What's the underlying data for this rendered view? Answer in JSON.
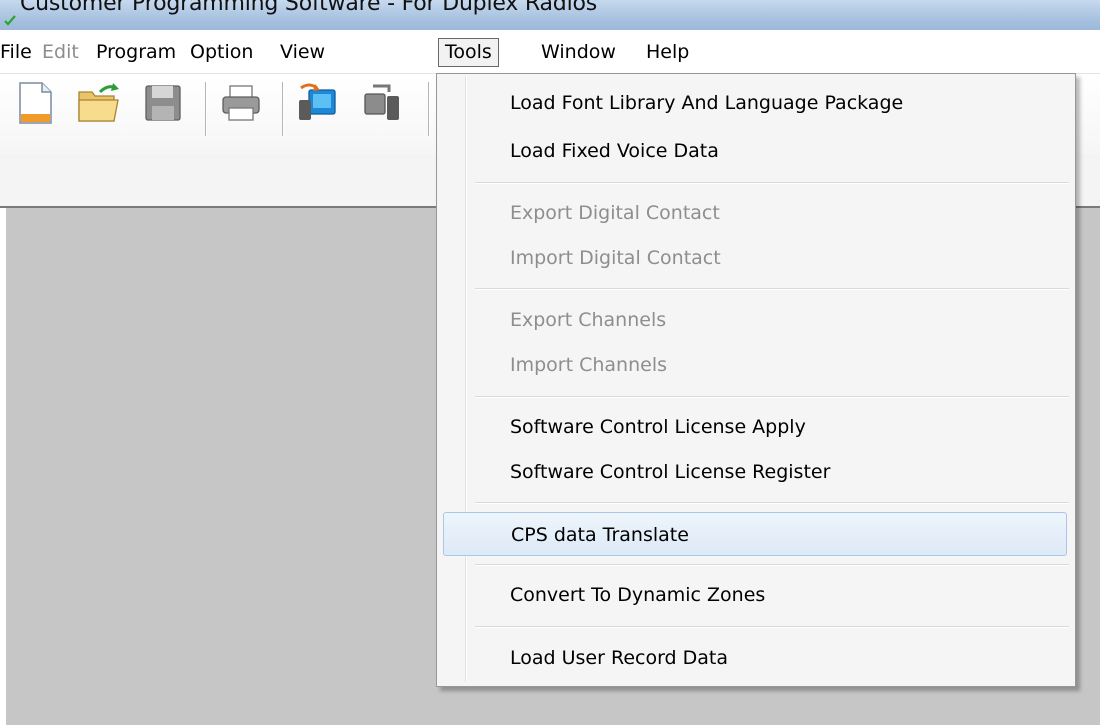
{
  "window": {
    "title": "Customer Programming Software - For Duplex Radios"
  },
  "menubar": {
    "items": [
      {
        "label": "File",
        "enabled": true
      },
      {
        "label": "Edit",
        "enabled": false
      },
      {
        "label": "Program",
        "enabled": true
      },
      {
        "label": "Option",
        "enabled": true
      },
      {
        "label": "View",
        "enabled": true
      },
      {
        "label": "Tools",
        "enabled": true,
        "open": true
      },
      {
        "label": "Window",
        "enabled": true
      },
      {
        "label": "Help",
        "enabled": true
      }
    ]
  },
  "toolbar": {
    "buttons": [
      {
        "icon": "new-file-icon"
      },
      {
        "icon": "open-folder-icon"
      },
      {
        "icon": "save-disk-icon"
      },
      {
        "icon": "print-icon"
      },
      {
        "icon": "read-from-radio-icon"
      },
      {
        "icon": "write-to-radio-icon"
      }
    ]
  },
  "tools_menu": {
    "items": [
      {
        "label": "Load Font Library And Language Package",
        "enabled": true
      },
      {
        "label": "Load Fixed Voice Data",
        "enabled": true
      },
      {
        "label": "Export Digital Contact",
        "enabled": false
      },
      {
        "label": "Import Digital Contact",
        "enabled": false
      },
      {
        "label": "Export Channels",
        "enabled": false
      },
      {
        "label": "Import Channels",
        "enabled": false
      },
      {
        "label": "Software Control License Apply",
        "enabled": true
      },
      {
        "label": "Software Control License Register",
        "enabled": true
      },
      {
        "label": "CPS data Translate",
        "enabled": true,
        "highlighted": true
      },
      {
        "label": "Convert To Dynamic Zones",
        "enabled": true
      },
      {
        "label": "Load User Record Data",
        "enabled": true
      }
    ]
  },
  "colors": {
    "menu_highlight_border": "#a8c8ea",
    "disabled_text": "#8e8e8e",
    "workspace": "#c6c6c6"
  }
}
